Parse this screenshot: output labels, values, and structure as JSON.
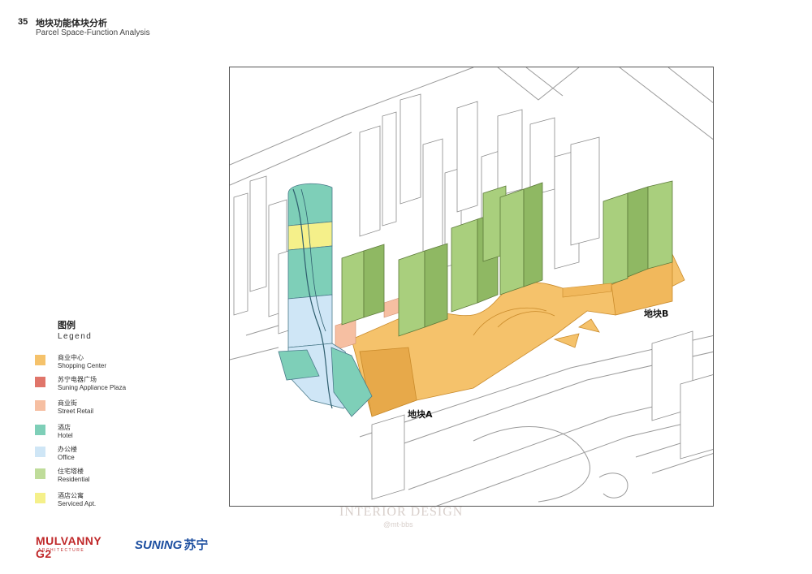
{
  "header": {
    "page_number": "35",
    "title_cn": "地块功能体块分析",
    "title_en": "Parcel Space-Function Analysis"
  },
  "legend": {
    "title_cn": "图例",
    "title_en": "Legend",
    "items": [
      {
        "cn": "商业中心",
        "en": "Shopping Center",
        "color": "#f5c26b"
      },
      {
        "cn": "苏宁电器广场",
        "en": "Suning Appliance Plaza",
        "color": "#e0756a"
      },
      {
        "cn": "商业街",
        "en": "Street Retail",
        "color": "#f6bfa2"
      },
      {
        "cn": "酒店",
        "en": "Hotel",
        "color": "#7ecfb8"
      },
      {
        "cn": "办公楼",
        "en": "Office",
        "color": "#cfe6f6"
      },
      {
        "cn": "住宅塔楼",
        "en": "Residential",
        "color": "#bfdc9a"
      },
      {
        "cn": "酒店公寓",
        "en": "Serviced Apt.",
        "color": "#f5f08a"
      }
    ]
  },
  "diagram": {
    "parcel_a_label": "地块A",
    "parcel_b_label": "地块B"
  },
  "logos": {
    "mulvanny": "MULVANNY G2",
    "mulvanny_sub": "ARCHITECTURE",
    "suning": "SUNING",
    "suning_cn": "苏宁"
  },
  "watermark": {
    "text": "INTERIOR DESIGN",
    "sub": "@mt-bbs"
  }
}
